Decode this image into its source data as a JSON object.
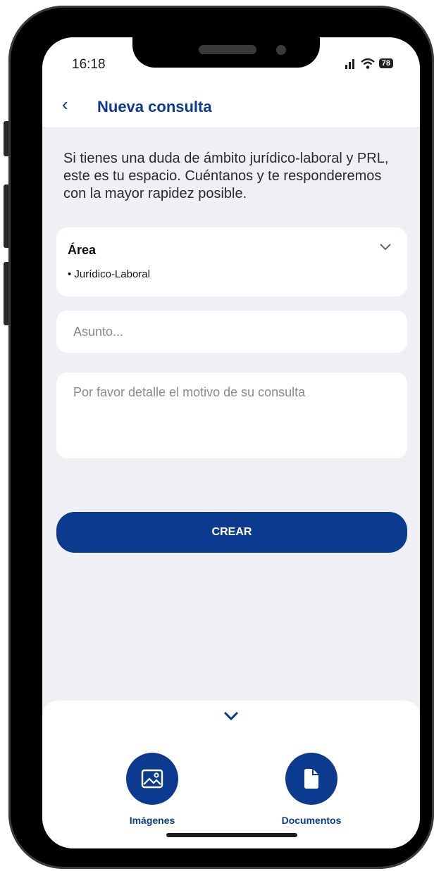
{
  "status_bar": {
    "time": "16:18",
    "battery": "78"
  },
  "app_bar": {
    "back_icon": "chevron-left-icon",
    "title": "Nueva consulta"
  },
  "intro_text": "Si tienes una duda de ámbito jurídico-laboral y PRL, este es tu espacio. Cuéntanos y te responderemos con la mayor rapidez posible.",
  "area": {
    "label": "Área",
    "value": "• Jurídico-Laboral"
  },
  "form": {
    "asunto_placeholder": "Asunto...",
    "motivo_placeholder": "Por favor detalle el motivo de su consulta"
  },
  "buttons": {
    "crear": "CREAR"
  },
  "attachments": {
    "images_label": "Imágenes",
    "documents_label": "Documentos"
  },
  "colors": {
    "primary": "#0c3a8f",
    "background": "#eef0f4"
  }
}
